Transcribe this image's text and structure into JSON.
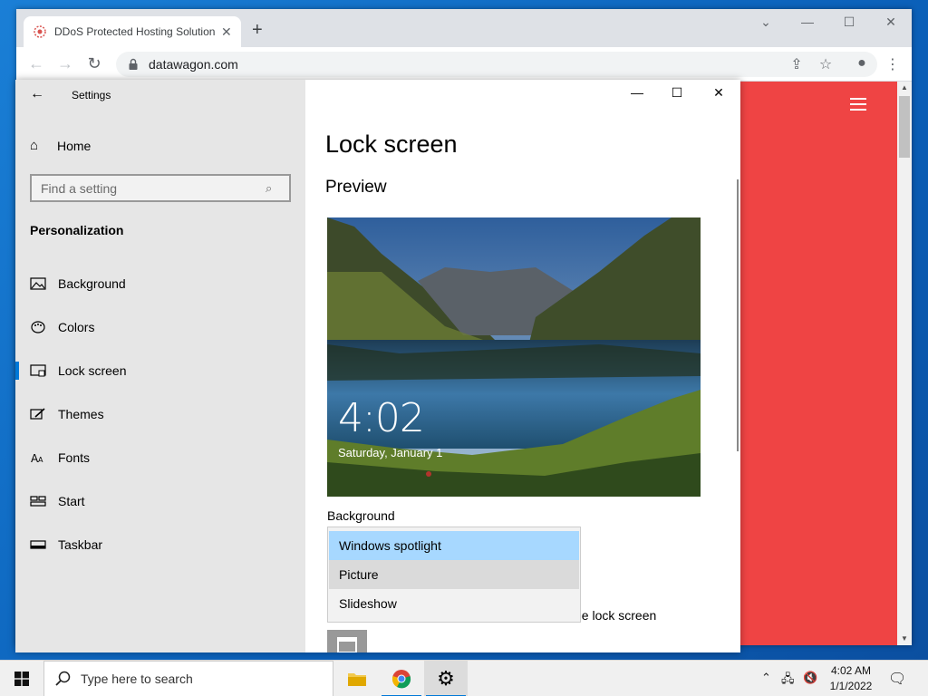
{
  "browser": {
    "tab_title": "DDoS Protected Hosting Solution",
    "url": "datawagon.com"
  },
  "settings": {
    "app_title": "Settings",
    "nav": {
      "home_label": "Home",
      "search_placeholder": "Find a setting",
      "section_title": "Personalization",
      "items": [
        {
          "label": "Background",
          "icon": "picture-icon",
          "active": false
        },
        {
          "label": "Colors",
          "icon": "palette-icon",
          "active": false
        },
        {
          "label": "Lock screen",
          "icon": "lock-screen-icon",
          "active": true
        },
        {
          "label": "Themes",
          "icon": "brush-icon",
          "active": false
        },
        {
          "label": "Fonts",
          "icon": "font-icon",
          "active": false
        },
        {
          "label": "Start",
          "icon": "start-icon",
          "active": false
        },
        {
          "label": "Taskbar",
          "icon": "taskbar-icon",
          "active": false
        }
      ]
    },
    "content": {
      "page_title": "Lock screen",
      "preview_heading": "Preview",
      "preview_time": "4:02",
      "preview_date": "Saturday, January 1",
      "background_label": "Background",
      "dropdown_options": [
        {
          "label": "Windows spotlight",
          "state": "selected"
        },
        {
          "label": "Picture",
          "state": "hover"
        },
        {
          "label": "Slideshow",
          "state": "normal"
        }
      ],
      "partial_text": "he lock screen"
    }
  },
  "taskbar": {
    "search_placeholder": "Type here to search",
    "time": "4:02 AM",
    "date": "1/1/2022"
  },
  "colors": {
    "accent": "#0078d7",
    "webpage_bg": "#ef4444",
    "dropdown_selected": "#a7d8ff"
  }
}
